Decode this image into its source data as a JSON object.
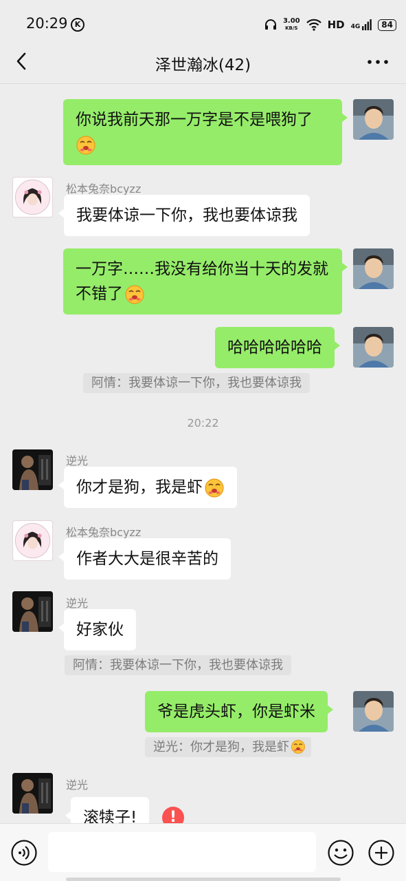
{
  "status_bar": {
    "time": "20:29",
    "k_badge": "K",
    "net_speed": "3.00",
    "net_unit": "KB/S",
    "hd": "HD",
    "signal": "4G",
    "battery": "84"
  },
  "header": {
    "title": "泽世瀚冰(42)"
  },
  "chat": {
    "messages": [
      {
        "text": "你说我前天那一万字是不是喂狗了"
      },
      {
        "sender": "松本兔奈bcyzz",
        "text": "我要体谅一下你，我也要体谅我"
      },
      {
        "text": "一万字……我没有给你当十天的发就不错了"
      },
      {
        "text": "哈哈哈哈哈哈",
        "quote": "阿情：我要体谅一下你，我也要体谅我"
      },
      {
        "sender": "逆光",
        "text": "你才是狗，我是虾"
      },
      {
        "sender": "松本兔奈bcyzz",
        "text": "作者大大是很辛苦的"
      },
      {
        "sender": "逆光",
        "text": "好家伙",
        "quote": "阿情：我要体谅一下你，我也要体谅我"
      },
      {
        "text": "爷是虎头虾，你是虾米",
        "quote": "逆光：你才是狗，我是虾"
      },
      {
        "sender": "逆光",
        "text": "滚犊子!",
        "error_mark": "!"
      }
    ],
    "timestamp": "20:22"
  },
  "colors": {
    "background": "#ededed",
    "bubble_sent": "#95ec69",
    "bubble_received": "#ffffff",
    "error": "#fa5151"
  },
  "icons": {
    "back": "chevron-left-icon",
    "more": "more-dots-icon",
    "voice": "voice-icon",
    "emoji": "emoji-icon",
    "plus": "plus-icon",
    "reaction": "drooling-face-emoji"
  }
}
